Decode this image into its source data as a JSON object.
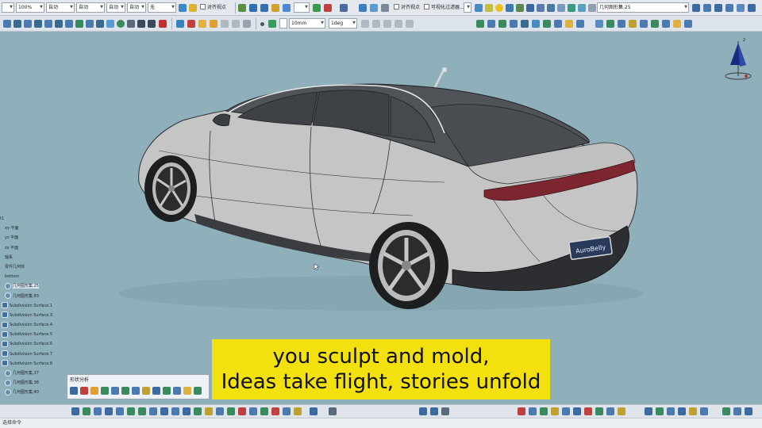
{
  "toolbar_top": {
    "zoom_value": "100%",
    "field_auto_1": "自动",
    "field_auto_2": "自动",
    "field_auto_3": "自动",
    "field_auto_4": "自动",
    "field_none": "无",
    "snap_label_1": "对齐视点",
    "snap_label_2": "对齐视点",
    "filter_label": "可视化过滤器...",
    "geometric_set_select": "几何图形集.25"
  },
  "toolbar_second": {
    "length_value": "10mm",
    "angle_value": "1deg"
  },
  "viewport": {
    "plate_text": "AuroBelly",
    "axis_label": "z"
  },
  "tree": {
    "items": [
      {
        "label": "t1",
        "icon": "part-icon"
      },
      {
        "label": "xy 平面",
        "icon": "plane-icon"
      },
      {
        "label": "yz 平面",
        "icon": "plane-icon"
      },
      {
        "label": "zx 平面",
        "icon": "plane-icon"
      },
      {
        "label": "轴系",
        "icon": "axis-system-icon"
      },
      {
        "label": "零件几何体",
        "icon": "body-icon"
      },
      {
        "label": "bottom",
        "icon": "geometric-set-icon"
      },
      {
        "label": "几何图形集.25",
        "icon": "geometric-set-icon"
      },
      {
        "label": "几何图形集.83",
        "icon": "geometric-set-icon"
      },
      {
        "label": "Subdivision Surface.1",
        "icon": "subdivision-surface-icon"
      },
      {
        "label": "Subdivision Surface.3",
        "icon": "subdivision-surface-icon"
      },
      {
        "label": "Subdivision Surface.4",
        "icon": "subdivision-surface-icon"
      },
      {
        "label": "Subdivision Surface.5",
        "icon": "subdivision-surface-icon"
      },
      {
        "label": "Subdivision Surface.6",
        "icon": "subdivision-surface-icon"
      },
      {
        "label": "Subdivision Surface.7",
        "icon": "subdivision-surface-icon"
      },
      {
        "label": "Subdivision Surface.8",
        "icon": "subdivision-surface-icon"
      },
      {
        "label": "几何图形集.37",
        "icon": "geometric-set-icon"
      },
      {
        "label": "几何图形集.38",
        "icon": "geometric-set-icon"
      },
      {
        "label": "几何图形集.40",
        "icon": "geometric-set-icon"
      }
    ]
  },
  "shape_panel": {
    "title": "形状分析"
  },
  "subtitle": {
    "line1": "you sculpt and mold,",
    "line2": "Ideas take flight, stories unfold",
    "bg_color": "#f2e00f"
  },
  "status": {
    "text": "选择命令"
  },
  "colors": {
    "viewport_bg": "#8fb0ba",
    "car_body": "#c8c9c8",
    "glass": "#5a5e62",
    "taillight": "#8a2b33",
    "compass_flag": "#1a2a80"
  }
}
